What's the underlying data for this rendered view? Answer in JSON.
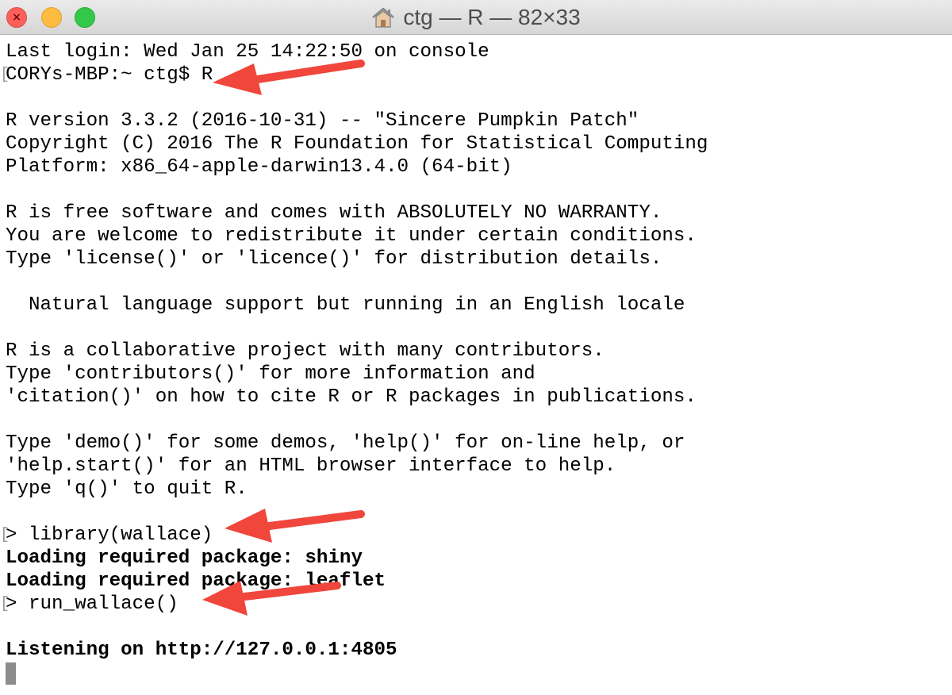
{
  "window": {
    "title": "ctg — R — 82×33"
  },
  "terminal": {
    "lines": [
      "Last login: Wed Jan 25 14:22:50 on console",
      "CORYs-MBP:~ ctg$ R",
      "",
      "R version 3.3.2 (2016-10-31) -- \"Sincere Pumpkin Patch\"",
      "Copyright (C) 2016 The R Foundation for Statistical Computing",
      "Platform: x86_64-apple-darwin13.4.0 (64-bit)",
      "",
      "R is free software and comes with ABSOLUTELY NO WARRANTY.",
      "You are welcome to redistribute it under certain conditions.",
      "Type 'license()' or 'licence()' for distribution details.",
      "",
      "  Natural language support but running in an English locale",
      "",
      "R is a collaborative project with many contributors.",
      "Type 'contributors()' for more information and",
      "'citation()' on how to cite R or R packages in publications.",
      "",
      "Type 'demo()' for some demos, 'help()' for on-line help, or",
      "'help.start()' for an HTML browser interface to help.",
      "Type 'q()' to quit R.",
      "",
      "> library(wallace)",
      "Loading required package: shiny",
      "Loading required package: leaflet",
      "> run_wallace()",
      "",
      "Listening on http://127.0.0.1:4805"
    ],
    "prompt_mark": "["
  },
  "colors": {
    "arrow": "#f0463c",
    "text": "#000000",
    "titlebar_text": "#4d4d4d"
  },
  "icons": {
    "title": "home-icon",
    "close": "close-icon",
    "minimize": "minimize-icon",
    "zoom": "zoom-icon",
    "annotation": "arrow-icon"
  }
}
